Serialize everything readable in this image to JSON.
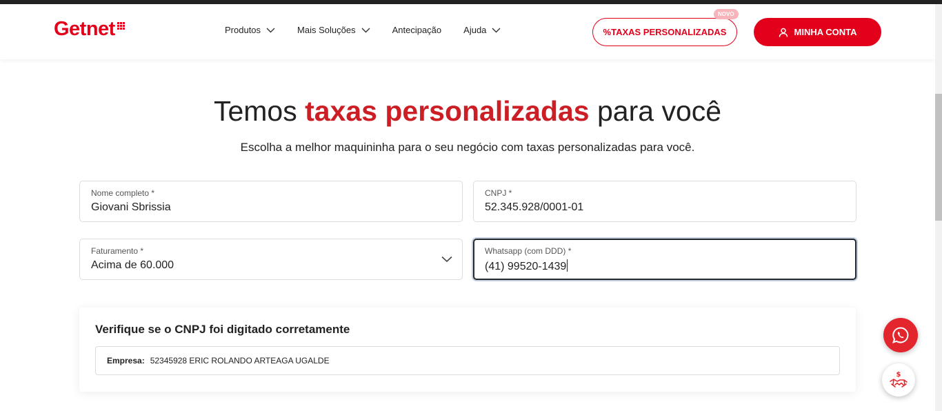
{
  "colors": {
    "brand_red": "#e3001b",
    "accent_red": "#cc1f25",
    "dark": "#222222"
  },
  "header": {
    "logo_text": "Getnet",
    "nav": [
      {
        "label": "Produtos",
        "has_dropdown": true
      },
      {
        "label": "Mais Soluções",
        "has_dropdown": true
      },
      {
        "label": "Antecipação",
        "has_dropdown": false
      },
      {
        "label": "Ajuda",
        "has_dropdown": true
      }
    ],
    "taxas_button": "%TAXAS PERSONALIZADAS",
    "novo_badge": "NOVO",
    "conta_button": "MINHA CONTA",
    "conta_icon": "user-icon"
  },
  "hero": {
    "title_pre": "Temos",
    "title_accent": "taxas personalizadas",
    "title_post": "para você",
    "subtitle": "Escolha a melhor maquininha para o seu negócio com taxas personalizadas para você."
  },
  "form": {
    "nome": {
      "label": "Nome completo *",
      "value": "Giovani Sbrissia"
    },
    "cnpj": {
      "label": "CNPJ *",
      "value": "52.345.928/0001-01"
    },
    "faturamento": {
      "label": "Faturamento *",
      "value": "Acima de 60.000"
    },
    "whatsapp": {
      "label": "Whatsapp (com DDD) *",
      "value": "(41) 99520-1439"
    }
  },
  "verify": {
    "title": "Verifique se o CNPJ foi digitado corretamente",
    "empresa_label": "Empresa:",
    "empresa_value": "52345928 ERIC ROLANDO ARTEAGA UGALDE"
  },
  "floating": {
    "whatsapp_icon": "whatsapp-icon",
    "deal_icon": "handshake-dollar-icon"
  }
}
